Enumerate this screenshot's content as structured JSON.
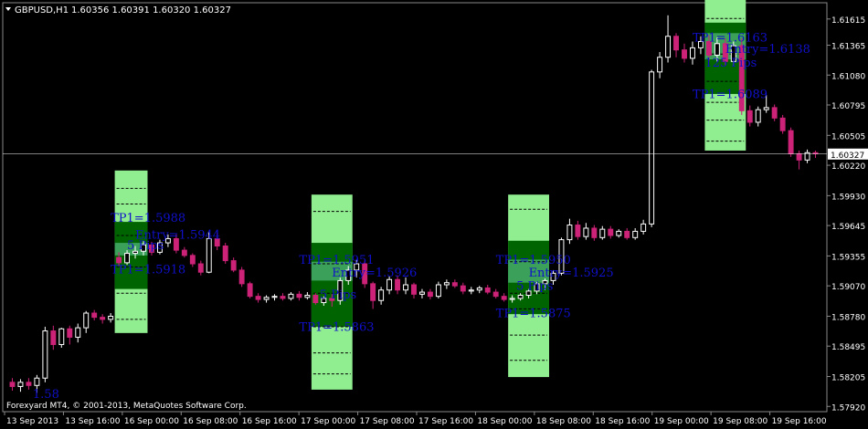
{
  "header": {
    "symbol_tf": "GBPUSD,H1",
    "ohlc": "1.60356 1.60391 1.60320 1.60327"
  },
  "footer": {
    "copyright": "Forexyard MT4, © 2001-2013, MetaQuotes Software Corp."
  },
  "colors": {
    "background": "#000000",
    "grid": "#777777",
    "bull": "#ffffff",
    "bear": "#cc2277",
    "tp_light": "#90ee90",
    "tp_dark": "#006400",
    "entry_band": "#3aa05a",
    "annotation": "#1010cc",
    "current_price_line": "#ffffff"
  },
  "chart_data": {
    "type": "candlestick",
    "symbol": "GBPUSD",
    "timeframe": "H1",
    "current_price": 1.60327,
    "y_ticks": [
      1.61615,
      1.61365,
      1.6108,
      1.60795,
      1.60505,
      1.6022,
      1.5993,
      1.59645,
      1.59355,
      1.5907,
      1.5878,
      1.58495,
      1.58205,
      1.5792
    ],
    "x_ticks": [
      "13 Sep 2013",
      "13 Sep 16:00",
      "16 Sep 00:00",
      "16 Sep 08:00",
      "16 Sep 16:00",
      "17 Sep 00:00",
      "17 Sep 08:00",
      "17 Sep 16:00",
      "18 Sep 00:00",
      "18 Sep 08:00",
      "18 Sep 16:00",
      "19 Sep 00:00",
      "19 Sep 08:00",
      "19 Sep 16:00"
    ],
    "ylim": [
      1.5787,
      1.6177
    ],
    "candles": [
      [
        1.5815,
        1.5819,
        1.5807,
        1.5811
      ],
      [
        1.5811,
        1.5818,
        1.5806,
        1.5815
      ],
      [
        1.5815,
        1.5819,
        1.5808,
        1.5812
      ],
      [
        1.5812,
        1.5822,
        1.5805,
        1.5819
      ],
      [
        1.5819,
        1.5868,
        1.5815,
        1.5864
      ],
      [
        1.5864,
        1.5869,
        1.5846,
        1.5851
      ],
      [
        1.5851,
        1.5867,
        1.5848,
        1.5866
      ],
      [
        1.5866,
        1.5869,
        1.5851,
        1.5858
      ],
      [
        1.5858,
        1.5871,
        1.5853,
        1.5867
      ],
      [
        1.5867,
        1.5883,
        1.5862,
        1.5881
      ],
      [
        1.5881,
        1.5884,
        1.5874,
        1.5877
      ],
      [
        1.5877,
        1.588,
        1.5871,
        1.5875
      ],
      [
        1.5875,
        1.5881,
        1.5872,
        1.5878
      ],
      [
        1.5934,
        1.5939,
        1.5926,
        1.5929
      ],
      [
        1.5929,
        1.5941,
        1.5927,
        1.5938
      ],
      [
        1.5938,
        1.5945,
        1.5933,
        1.594
      ],
      [
        1.594,
        1.595,
        1.5936,
        1.5946
      ],
      [
        1.5946,
        1.5949,
        1.5936,
        1.5939
      ],
      [
        1.5939,
        1.5951,
        1.5937,
        1.5948
      ],
      [
        1.5948,
        1.5956,
        1.5944,
        1.5952
      ],
      [
        1.5952,
        1.5956,
        1.5938,
        1.5941
      ],
      [
        1.5941,
        1.5944,
        1.5934,
        1.5936
      ],
      [
        1.5936,
        1.5938,
        1.5925,
        1.5928
      ],
      [
        1.5928,
        1.5931,
        1.5917,
        1.592
      ],
      [
        1.592,
        1.5958,
        1.5919,
        1.5952
      ],
      [
        1.5952,
        1.5958,
        1.5941,
        1.5945
      ],
      [
        1.5945,
        1.5948,
        1.5928,
        1.5931
      ],
      [
        1.5931,
        1.5934,
        1.592,
        1.5922
      ],
      [
        1.5922,
        1.5925,
        1.5906,
        1.5909
      ],
      [
        1.5909,
        1.5911,
        1.5895,
        1.5897
      ],
      [
        1.5897,
        1.59,
        1.5891,
        1.5894
      ],
      [
        1.5894,
        1.5898,
        1.5891,
        1.5896
      ],
      [
        1.5896,
        1.5899,
        1.5893,
        1.5897
      ],
      [
        1.5897,
        1.59,
        1.5893,
        1.5895
      ],
      [
        1.5895,
        1.5901,
        1.5893,
        1.5899
      ],
      [
        1.5899,
        1.5902,
        1.5893,
        1.5896
      ],
      [
        1.5896,
        1.5901,
        1.5894,
        1.5898
      ],
      [
        1.5898,
        1.59,
        1.5889,
        1.5891
      ],
      [
        1.5891,
        1.5897,
        1.5888,
        1.5895
      ],
      [
        1.5895,
        1.5899,
        1.5887,
        1.5893
      ],
      [
        1.5893,
        1.5915,
        1.5889,
        1.5912
      ],
      [
        1.5912,
        1.5926,
        1.5908,
        1.5922
      ],
      [
        1.5922,
        1.5932,
        1.5915,
        1.5928
      ],
      [
        1.5928,
        1.5931,
        1.5905,
        1.5909
      ],
      [
        1.5909,
        1.5911,
        1.5885,
        1.5893
      ],
      [
        1.5893,
        1.5906,
        1.5889,
        1.5903
      ],
      [
        1.5903,
        1.5916,
        1.5899,
        1.5913
      ],
      [
        1.5913,
        1.5917,
        1.5899,
        1.5903
      ],
      [
        1.5903,
        1.5915,
        1.5899,
        1.5908
      ],
      [
        1.5908,
        1.591,
        1.5895,
        1.5899
      ],
      [
        1.5899,
        1.5904,
        1.5895,
        1.5901
      ],
      [
        1.5901,
        1.5904,
        1.5894,
        1.5897
      ],
      [
        1.5897,
        1.5911,
        1.5895,
        1.5908
      ],
      [
        1.5908,
        1.5913,
        1.5904,
        1.591
      ],
      [
        1.591,
        1.5913,
        1.5905,
        1.5907
      ],
      [
        1.5907,
        1.591,
        1.5899,
        1.5902
      ],
      [
        1.5902,
        1.5906,
        1.5899,
        1.5903
      ],
      [
        1.5903,
        1.5907,
        1.59,
        1.5905
      ],
      [
        1.5905,
        1.5908,
        1.5899,
        1.5901
      ],
      [
        1.5901,
        1.5904,
        1.5895,
        1.5897
      ],
      [
        1.5897,
        1.59,
        1.5892,
        1.5894
      ],
      [
        1.5894,
        1.5898,
        1.5891,
        1.5895
      ],
      [
        1.5895,
        1.59,
        1.5893,
        1.5898
      ],
      [
        1.5898,
        1.5904,
        1.5895,
        1.5902
      ],
      [
        1.5902,
        1.5911,
        1.5899,
        1.5909
      ],
      [
        1.5909,
        1.5914,
        1.5903,
        1.5912
      ],
      [
        1.5912,
        1.5922,
        1.5908,
        1.5919
      ],
      [
        1.5919,
        1.5953,
        1.5917,
        1.5951
      ],
      [
        1.5951,
        1.5971,
        1.5947,
        1.5965
      ],
      [
        1.5965,
        1.5969,
        1.5951,
        1.5954
      ],
      [
        1.5954,
        1.5967,
        1.5951,
        1.5962
      ],
      [
        1.5962,
        1.5965,
        1.595,
        1.5953
      ],
      [
        1.5953,
        1.5964,
        1.5951,
        1.5961
      ],
      [
        1.5961,
        1.5964,
        1.5952,
        1.5955
      ],
      [
        1.5955,
        1.5961,
        1.5953,
        1.5959
      ],
      [
        1.5959,
        1.5962,
        1.5951,
        1.5953
      ],
      [
        1.5953,
        1.5962,
        1.5951,
        1.5959
      ],
      [
        1.5959,
        1.597,
        1.5956,
        1.5966
      ],
      [
        1.5966,
        1.6113,
        1.5963,
        1.6111
      ],
      [
        1.6111,
        1.613,
        1.6105,
        1.6125
      ],
      [
        1.6125,
        1.6165,
        1.612,
        1.6145
      ],
      [
        1.6145,
        1.6148,
        1.6125,
        1.6132
      ],
      [
        1.6132,
        1.6138,
        1.612,
        1.6124
      ],
      [
        1.6124,
        1.614,
        1.6118,
        1.6134
      ],
      [
        1.6134,
        1.6145,
        1.6128,
        1.614
      ],
      [
        1.614,
        1.6146,
        1.6121,
        1.6127
      ],
      [
        1.6127,
        1.6144,
        1.6121,
        1.6138
      ],
      [
        1.6138,
        1.6143,
        1.6117,
        1.6121
      ],
      [
        1.6121,
        1.614,
        1.6117,
        1.6136
      ],
      [
        1.6136,
        1.6143,
        1.607,
        1.6074
      ],
      [
        1.6074,
        1.6079,
        1.6059,
        1.6063
      ],
      [
        1.6063,
        1.6078,
        1.6059,
        1.6075
      ],
      [
        1.6075,
        1.6089,
        1.6072,
        1.6077
      ],
      [
        1.6077,
        1.608,
        1.6064,
        1.6067
      ],
      [
        1.6067,
        1.607,
        1.6052,
        1.6055
      ],
      [
        1.6055,
        1.6058,
        1.603,
        1.6033
      ],
      [
        1.6033,
        1.6036,
        1.6018,
        1.6027
      ],
      [
        1.6027,
        1.6037,
        1.6024,
        1.6034
      ],
      [
        1.6034,
        1.6036,
        1.6029,
        1.6033
      ]
    ],
    "trade_setups": [
      {
        "x_from": 13,
        "x_to": 16,
        "tp_light_top": 1.6017,
        "tp_dark_top": 1.5968,
        "tp_dark_bottom": 1.5904,
        "tp_light_bottom": 1.5862,
        "entry_top": 1.5948,
        "entry_bottom": 1.5936,
        "dashes": [
          1.6,
          1.5985,
          1.5955,
          1.5925,
          1.59,
          1.5875
        ]
      },
      {
        "x_from": 37,
        "x_to": 41,
        "tp_light_top": 1.5994,
        "tp_dark_top": 1.5948,
        "tp_dark_bottom": 1.5868,
        "tp_light_bottom": 1.5808,
        "entry_top": 1.593,
        "entry_bottom": 1.5912,
        "dashes": [
          1.5978,
          1.5928,
          1.59,
          1.5868,
          1.5843,
          1.5823
        ]
      },
      {
        "x_from": 61,
        "x_to": 65,
        "tp_light_top": 1.5994,
        "tp_dark_top": 1.595,
        "tp_dark_bottom": 1.588,
        "tp_light_bottom": 1.582,
        "entry_top": 1.5932,
        "entry_bottom": 1.591,
        "dashes": [
          1.598,
          1.593,
          1.59,
          1.5885,
          1.586,
          1.5836
        ]
      },
      {
        "x_from": 85,
        "x_to": 89,
        "tp_light_top": 1.6182,
        "tp_dark_top": 1.6158,
        "tp_dark_bottom": 1.609,
        "tp_light_bottom": 1.6036,
        "entry_top": 1.6148,
        "entry_bottom": 1.6123,
        "dashes": [
          1.6162,
          1.6128,
          1.6102,
          1.6082,
          1.6065,
          1.6045
        ]
      }
    ],
    "annotations": [
      {
        "text": "TP1=1.5988",
        "x": 12.5,
        "y": 1.5968
      },
      {
        "text": "Entry=1.5944",
        "x": 15.5,
        "y": 1.5952
      },
      {
        "text": "5 Pips",
        "x": 14.5,
        "y": 1.5942
      },
      {
        "text": "TP1=1.5918",
        "x": 12.5,
        "y": 1.5919
      },
      {
        "text": "TP1=1.5951",
        "x": 35.5,
        "y": 1.5928
      },
      {
        "text": "Entry=1.5926",
        "x": 39.5,
        "y": 1.5916
      },
      {
        "text": "5 Pips",
        "x": 38.0,
        "y": 1.5895
      },
      {
        "text": "TP1=1.5863",
        "x": 35.5,
        "y": 1.5864
      },
      {
        "text": "TP1=1.5950",
        "x": 59.5,
        "y": 1.5928
      },
      {
        "text": "Entry=1.5925",
        "x": 63.5,
        "y": 1.5916
      },
      {
        "text": "5 Pips",
        "x": 62.0,
        "y": 1.5903
      },
      {
        "text": "TP1=1.5875",
        "x": 59.5,
        "y": 1.5877
      },
      {
        "text": "TP1=1.6163",
        "x": 83.5,
        "y": 1.614
      },
      {
        "text": "Entry=1.6138",
        "x": 87.5,
        "y": 1.6129
      },
      {
        "text": "125 Pips",
        "x": 85.0,
        "y": 1.6116
      },
      {
        "text": "TP1=1.6089",
        "x": 83.5,
        "y": 1.6086
      },
      {
        "text": "1.58",
        "x": 3.0,
        "y": 1.58
      }
    ]
  }
}
